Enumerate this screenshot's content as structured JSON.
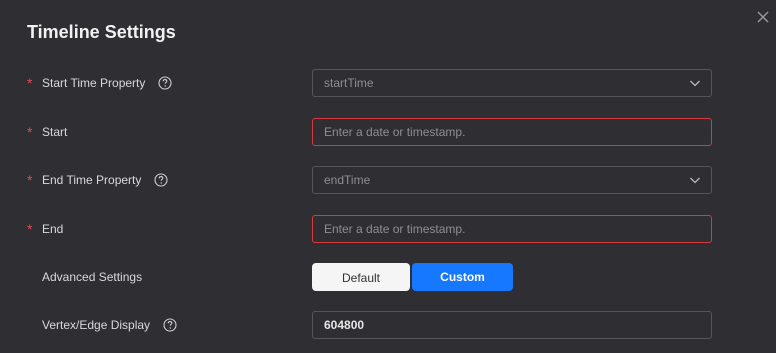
{
  "dialog": {
    "title": "Timeline Settings"
  },
  "fields": {
    "start_time_property": {
      "label": "Start Time Property",
      "required": true,
      "value": "startTime"
    },
    "start": {
      "label": "Start",
      "required": true,
      "placeholder": "Enter a date or timestamp."
    },
    "end_time_property": {
      "label": "End Time Property",
      "required": true,
      "value": "endTime"
    },
    "end": {
      "label": "End",
      "required": true,
      "placeholder": "Enter a date or timestamp."
    },
    "advanced_settings": {
      "label": "Advanced Settings",
      "options": [
        "Default",
        "Custom"
      ],
      "selected": "Custom"
    },
    "vertex_edge_display": {
      "label": "Vertex/Edge Display",
      "value": "604800"
    }
  },
  "icons": {
    "close": "close-icon",
    "help": "question-circle-icon",
    "dropdown": "chevron-down-icon"
  },
  "colors": {
    "background": "#2f2f33",
    "required_star": "#e5484d",
    "error_border": "#d93a3f",
    "primary": "#1677ff"
  }
}
